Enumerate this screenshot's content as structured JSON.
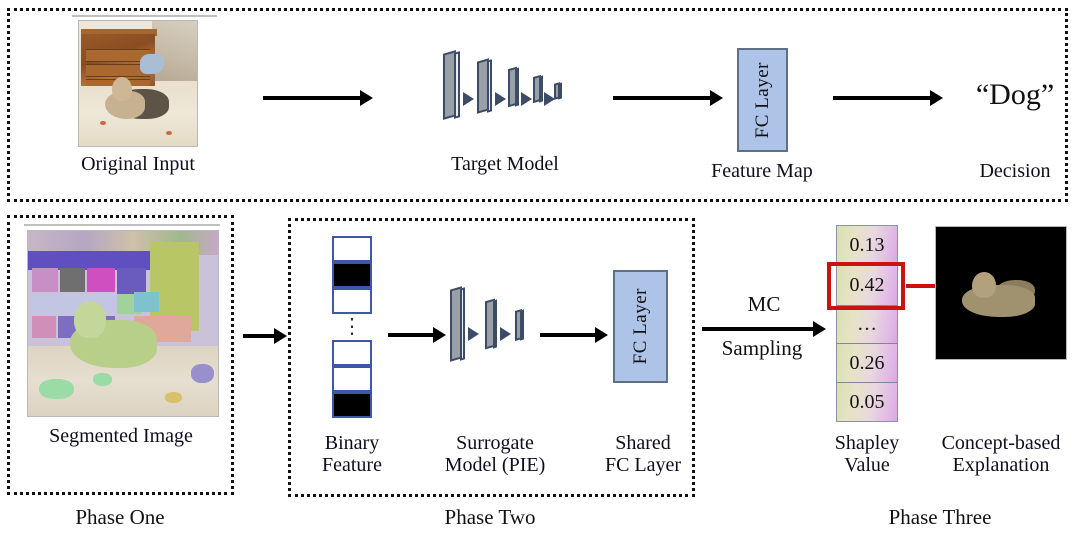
{
  "figure": {
    "title": "Three-phase concept-based explanation pipeline",
    "accent_blue": "#aec3e8",
    "accent_red": "#cc1111",
    "slab_gray": "#9aa0a8",
    "slab_outline": "#3d4c66"
  },
  "phases": {
    "one": "Phase One",
    "two": "Phase Two",
    "three": "Phase Three"
  },
  "row_top": {
    "original_input": {
      "caption": "Original Input",
      "image_alt": "photo of a dog lying on a bed in front of a wooden dresser"
    },
    "target_model": {
      "caption": "Target Model",
      "layer_count": 5
    },
    "feature_map": {
      "caption": "Feature Map",
      "box_label_line1": "FC",
      "box_label_line2": "Layer"
    },
    "decision": {
      "caption": "Decision",
      "value": "“Dog”"
    }
  },
  "row_bottom": {
    "segmented_image": {
      "caption": "Segmented Image",
      "image_alt": "superpixel-segmented version of the dog photo"
    },
    "binary_feature": {
      "caption_line1": "Binary",
      "caption_line2": "Feature",
      "top_cells": [
        "white",
        "black",
        "white"
      ],
      "bottom_cells": [
        "white",
        "white",
        "black"
      ],
      "ellipsis": "⋮"
    },
    "surrogate_model": {
      "caption_line1": "Surrogate",
      "caption_line2": "Model (PIE)",
      "layer_count": 3
    },
    "shared_fc": {
      "caption_line1": "Shared",
      "caption_line2": "FC Layer",
      "box_label_line1": "FC",
      "box_label_line2": "Layer"
    },
    "mc_sampling": {
      "label_line1": "MC",
      "label_line2": "Sampling"
    },
    "shapley": {
      "caption_line1": "Shapley",
      "caption_line2": "Value",
      "values": [
        "0.13",
        "0.42",
        "…",
        "0.26",
        "0.05"
      ],
      "highlighted_index": 1,
      "highlighted_value": "0.42"
    },
    "explanation": {
      "caption_line1": "Concept-based",
      "caption_line2": "Explanation",
      "image_alt": "masked photo showing only the dog on a black background"
    }
  }
}
